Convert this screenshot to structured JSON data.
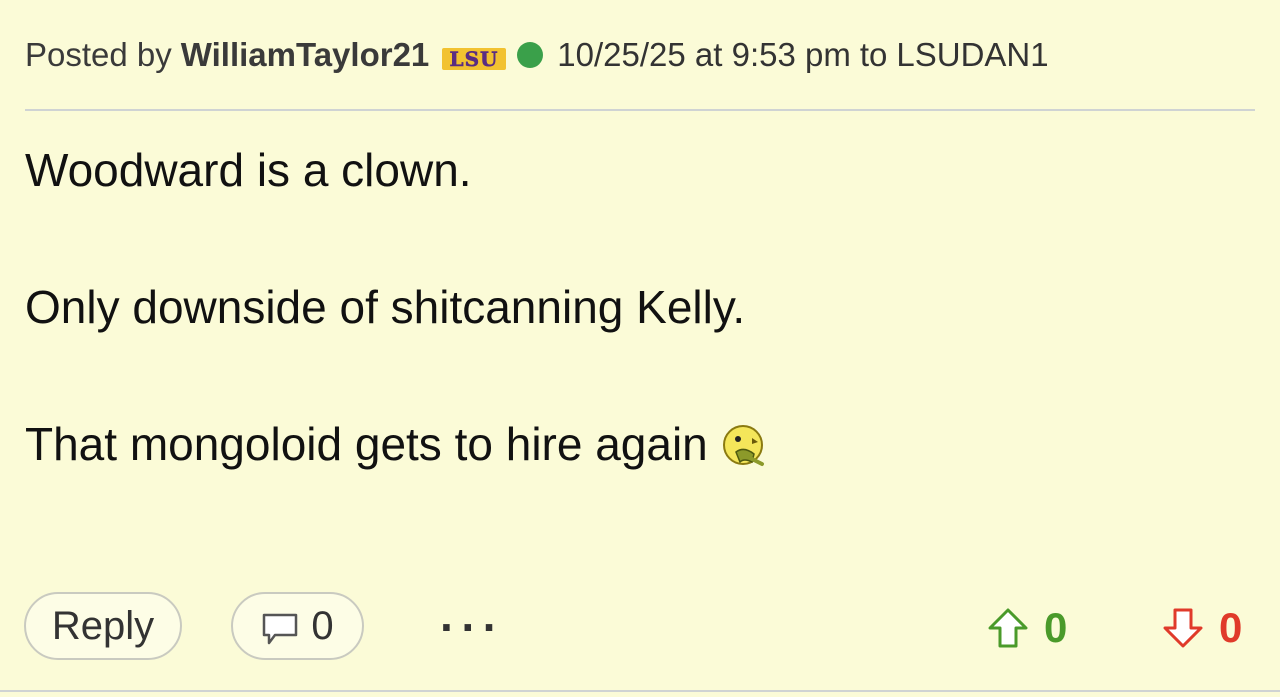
{
  "post": {
    "posted_by_label": "Posted by",
    "username": "WilliamTaylor21",
    "team_logo_text": "LSU",
    "timestamp": "10/25/25 at 9:53 pm",
    "to_label": "to",
    "reply_to": "LSUDAN1",
    "lines": [
      "Woodward is a clown.",
      "Only downside of shitcanning Kelly.",
      "That mongoloid gets to hire again"
    ],
    "emoji": "puking-smiley-icon"
  },
  "footer": {
    "reply_label": "Reply",
    "comment_count": "0",
    "more_label": "···",
    "upvotes": "0",
    "downvotes": "0"
  },
  "colors": {
    "background": "#fbfbd7",
    "online": "#3aa04a",
    "upvote": "#4a9a2a",
    "downvote": "#e03a2a",
    "lsu_purple": "#5a2d82",
    "lsu_gold": "#f2c230"
  }
}
